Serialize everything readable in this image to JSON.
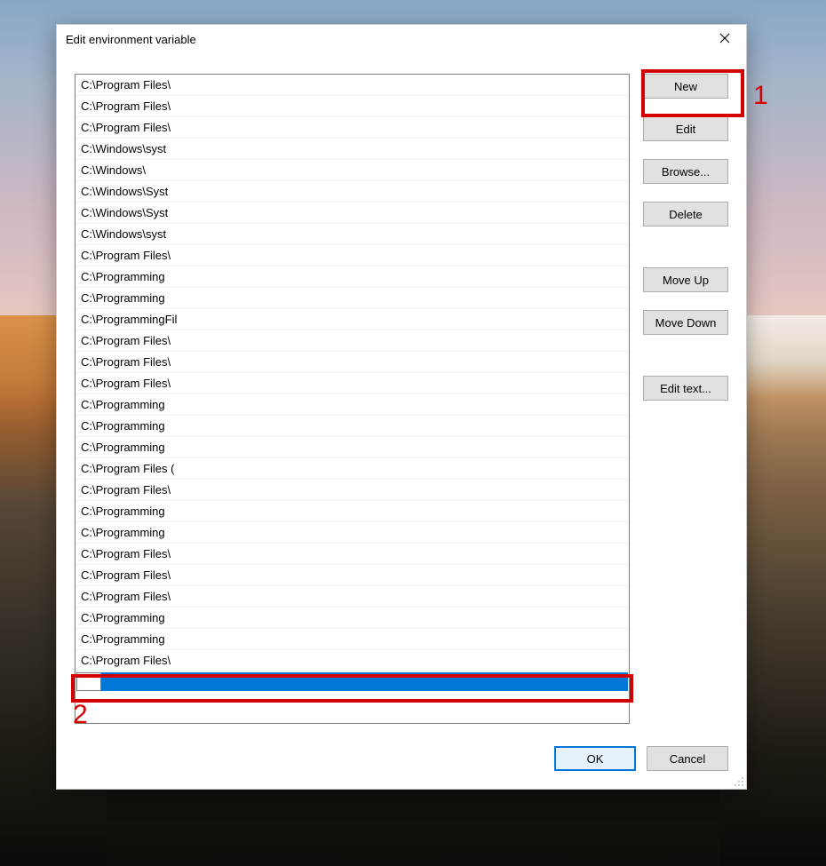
{
  "dialog": {
    "title": "Edit environment variable"
  },
  "list": {
    "items": [
      "C:\\Program Files\\",
      "C:\\Program Files\\",
      "C:\\Program Files\\",
      "C:\\Windows\\syst",
      "C:\\Windows\\",
      "C:\\Windows\\Syst",
      "C:\\Windows\\Syst",
      "C:\\Windows\\syst",
      "C:\\Program Files\\",
      "C:\\Programming",
      "C:\\Programming",
      "C:\\ProgrammingFil",
      "C:\\Program Files\\",
      "C:\\Program Files\\",
      "C:\\Program Files\\",
      "C:\\Programming",
      "C:\\Programming",
      "C:\\Programming",
      "C:\\Program Files (",
      "C:\\Program Files\\",
      "C:\\Programming",
      "C:\\Programming",
      "C:\\Program Files\\",
      "C:\\Program Files\\",
      "C:\\Program Files\\",
      "C:\\Programming",
      "C:\\Programming",
      "C:\\Program Files\\"
    ],
    "new_entry": ""
  },
  "buttons": {
    "new": "New",
    "edit": "Edit",
    "browse": "Browse...",
    "delete": "Delete",
    "move_up": "Move Up",
    "move_down": "Move Down",
    "edit_text": "Edit text...",
    "ok": "OK",
    "cancel": "Cancel"
  },
  "annotations": {
    "one": "1",
    "two": "2"
  }
}
